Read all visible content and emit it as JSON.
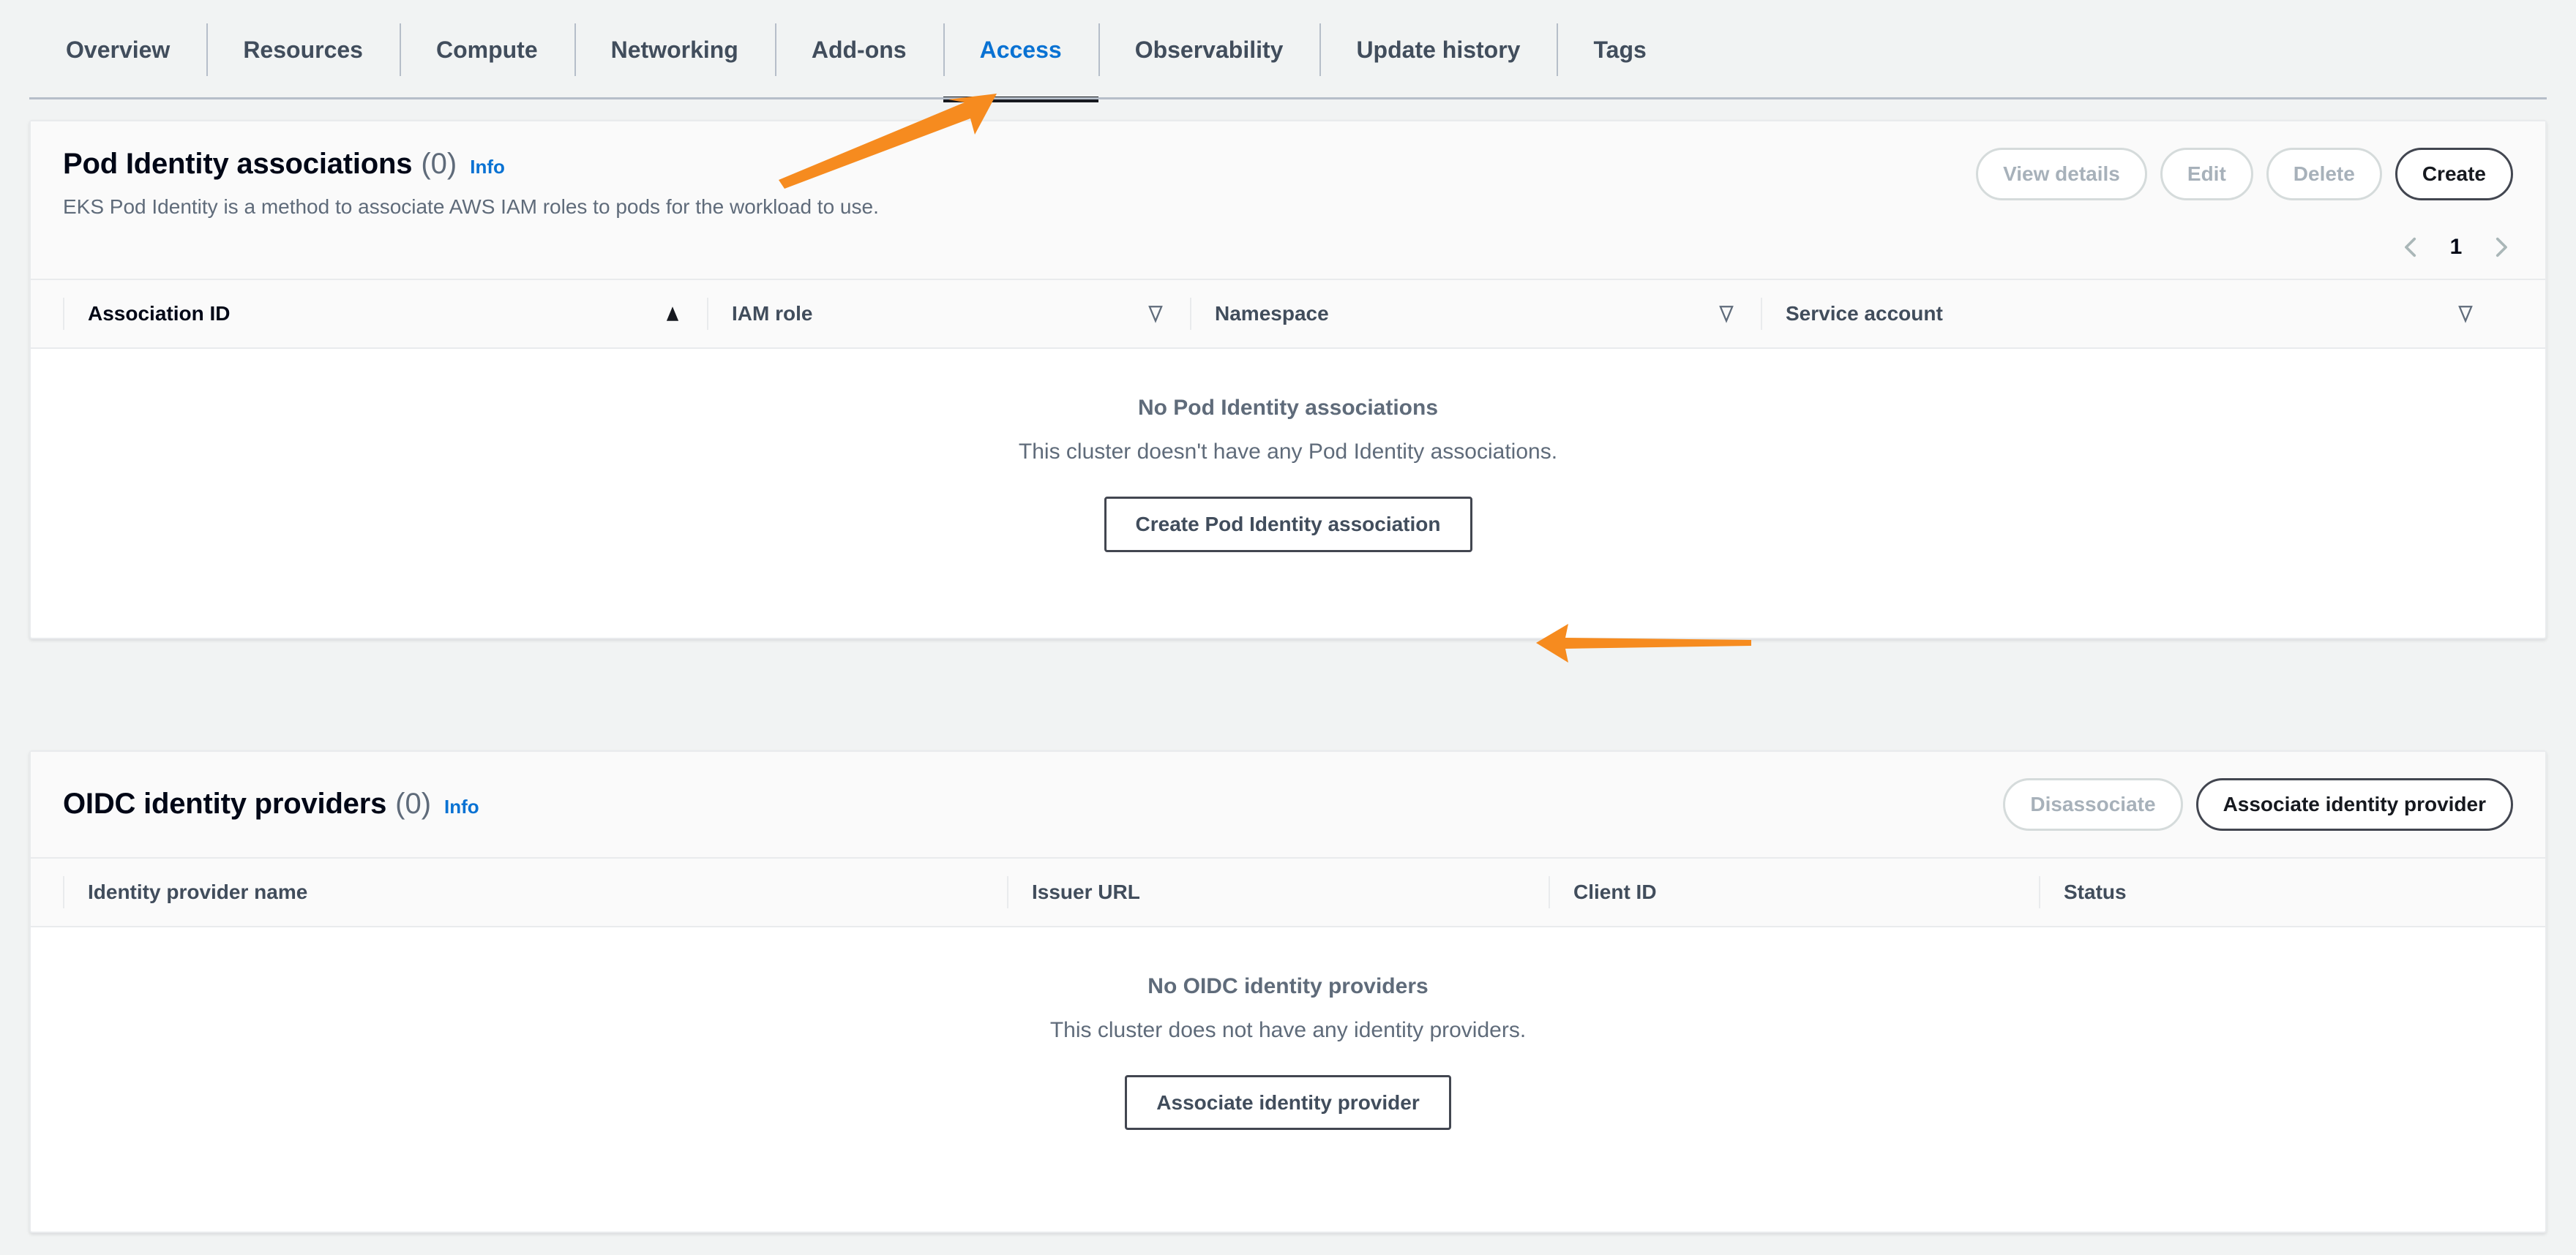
{
  "tabs": [
    {
      "label": "Overview",
      "active": false
    },
    {
      "label": "Resources",
      "active": false
    },
    {
      "label": "Compute",
      "active": false
    },
    {
      "label": "Networking",
      "active": false
    },
    {
      "label": "Add-ons",
      "active": false
    },
    {
      "label": "Access",
      "active": true
    },
    {
      "label": "Observability",
      "active": false
    },
    {
      "label": "Update history",
      "active": false
    },
    {
      "label": "Tags",
      "active": false
    }
  ],
  "pod_identity": {
    "title": "Pod Identity associations",
    "count": "(0)",
    "info_label": "Info",
    "description": "EKS Pod Identity is a method to associate AWS IAM roles to pods for the workload to use.",
    "actions": {
      "view_details": "View details",
      "edit": "Edit",
      "delete": "Delete",
      "create": "Create"
    },
    "pagination": {
      "prev_icon": "chevron-left-icon",
      "page": "1",
      "next_icon": "chevron-right-icon"
    },
    "columns": [
      {
        "label": "Association ID",
        "sort": "asc"
      },
      {
        "label": "IAM role",
        "sort": "none"
      },
      {
        "label": "Namespace",
        "sort": "none"
      },
      {
        "label": "Service account",
        "sort": "none"
      }
    ],
    "rows": [],
    "empty": {
      "title": "No Pod Identity associations",
      "subtitle": "This cluster doesn't have any Pod Identity associations.",
      "button": "Create Pod Identity association"
    }
  },
  "oidc": {
    "title": "OIDC identity providers",
    "count": "(0)",
    "info_label": "Info",
    "actions": {
      "disassociate": "Disassociate",
      "associate": "Associate identity provider"
    },
    "columns": [
      {
        "label": "Identity provider name"
      },
      {
        "label": "Issuer URL"
      },
      {
        "label": "Client ID"
      },
      {
        "label": "Status"
      }
    ],
    "rows": [],
    "empty": {
      "title": "No OIDC identity providers",
      "subtitle": "This cluster does not have any identity providers.",
      "button": "Associate identity provider"
    }
  },
  "annotations": {
    "color": "#f68b1f",
    "arrow_to_access_tab": "arrow-annotation-icon",
    "arrow_to_create_button": "arrow-annotation-icon"
  },
  "colors": {
    "accent_link": "#0972d3",
    "annotation_orange": "#f68b1f",
    "page_background": "#f1f3f3",
    "card_background": "#ffffff"
  }
}
